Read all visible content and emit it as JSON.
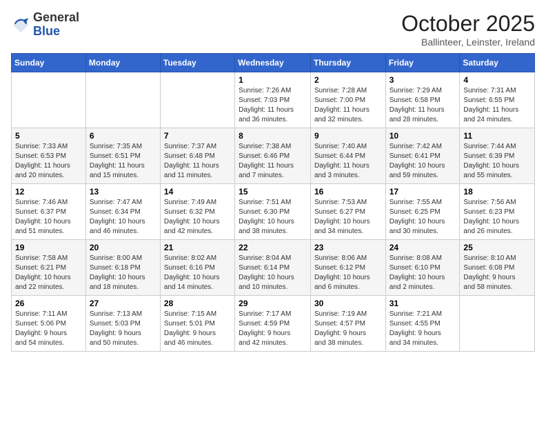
{
  "header": {
    "logo_general": "General",
    "logo_blue": "Blue",
    "month_title": "October 2025",
    "location": "Ballinteer, Leinster, Ireland"
  },
  "days_of_week": [
    "Sunday",
    "Monday",
    "Tuesday",
    "Wednesday",
    "Thursday",
    "Friday",
    "Saturday"
  ],
  "weeks": [
    [
      {
        "day": "",
        "info": ""
      },
      {
        "day": "",
        "info": ""
      },
      {
        "day": "",
        "info": ""
      },
      {
        "day": "1",
        "info": "Sunrise: 7:26 AM\nSunset: 7:03 PM\nDaylight: 11 hours\nand 36 minutes."
      },
      {
        "day": "2",
        "info": "Sunrise: 7:28 AM\nSunset: 7:00 PM\nDaylight: 11 hours\nand 32 minutes."
      },
      {
        "day": "3",
        "info": "Sunrise: 7:29 AM\nSunset: 6:58 PM\nDaylight: 11 hours\nand 28 minutes."
      },
      {
        "day": "4",
        "info": "Sunrise: 7:31 AM\nSunset: 6:55 PM\nDaylight: 11 hours\nand 24 minutes."
      }
    ],
    [
      {
        "day": "5",
        "info": "Sunrise: 7:33 AM\nSunset: 6:53 PM\nDaylight: 11 hours\nand 20 minutes."
      },
      {
        "day": "6",
        "info": "Sunrise: 7:35 AM\nSunset: 6:51 PM\nDaylight: 11 hours\nand 15 minutes."
      },
      {
        "day": "7",
        "info": "Sunrise: 7:37 AM\nSunset: 6:48 PM\nDaylight: 11 hours\nand 11 minutes."
      },
      {
        "day": "8",
        "info": "Sunrise: 7:38 AM\nSunset: 6:46 PM\nDaylight: 11 hours\nand 7 minutes."
      },
      {
        "day": "9",
        "info": "Sunrise: 7:40 AM\nSunset: 6:44 PM\nDaylight: 11 hours\nand 3 minutes."
      },
      {
        "day": "10",
        "info": "Sunrise: 7:42 AM\nSunset: 6:41 PM\nDaylight: 10 hours\nand 59 minutes."
      },
      {
        "day": "11",
        "info": "Sunrise: 7:44 AM\nSunset: 6:39 PM\nDaylight: 10 hours\nand 55 minutes."
      }
    ],
    [
      {
        "day": "12",
        "info": "Sunrise: 7:46 AM\nSunset: 6:37 PM\nDaylight: 10 hours\nand 51 minutes."
      },
      {
        "day": "13",
        "info": "Sunrise: 7:47 AM\nSunset: 6:34 PM\nDaylight: 10 hours\nand 46 minutes."
      },
      {
        "day": "14",
        "info": "Sunrise: 7:49 AM\nSunset: 6:32 PM\nDaylight: 10 hours\nand 42 minutes."
      },
      {
        "day": "15",
        "info": "Sunrise: 7:51 AM\nSunset: 6:30 PM\nDaylight: 10 hours\nand 38 minutes."
      },
      {
        "day": "16",
        "info": "Sunrise: 7:53 AM\nSunset: 6:27 PM\nDaylight: 10 hours\nand 34 minutes."
      },
      {
        "day": "17",
        "info": "Sunrise: 7:55 AM\nSunset: 6:25 PM\nDaylight: 10 hours\nand 30 minutes."
      },
      {
        "day": "18",
        "info": "Sunrise: 7:56 AM\nSunset: 6:23 PM\nDaylight: 10 hours\nand 26 minutes."
      }
    ],
    [
      {
        "day": "19",
        "info": "Sunrise: 7:58 AM\nSunset: 6:21 PM\nDaylight: 10 hours\nand 22 minutes."
      },
      {
        "day": "20",
        "info": "Sunrise: 8:00 AM\nSunset: 6:18 PM\nDaylight: 10 hours\nand 18 minutes."
      },
      {
        "day": "21",
        "info": "Sunrise: 8:02 AM\nSunset: 6:16 PM\nDaylight: 10 hours\nand 14 minutes."
      },
      {
        "day": "22",
        "info": "Sunrise: 8:04 AM\nSunset: 6:14 PM\nDaylight: 10 hours\nand 10 minutes."
      },
      {
        "day": "23",
        "info": "Sunrise: 8:06 AM\nSunset: 6:12 PM\nDaylight: 10 hours\nand 6 minutes."
      },
      {
        "day": "24",
        "info": "Sunrise: 8:08 AM\nSunset: 6:10 PM\nDaylight: 10 hours\nand 2 minutes."
      },
      {
        "day": "25",
        "info": "Sunrise: 8:10 AM\nSunset: 6:08 PM\nDaylight: 9 hours\nand 58 minutes."
      }
    ],
    [
      {
        "day": "26",
        "info": "Sunrise: 7:11 AM\nSunset: 5:06 PM\nDaylight: 9 hours\nand 54 minutes."
      },
      {
        "day": "27",
        "info": "Sunrise: 7:13 AM\nSunset: 5:03 PM\nDaylight: 9 hours\nand 50 minutes."
      },
      {
        "day": "28",
        "info": "Sunrise: 7:15 AM\nSunset: 5:01 PM\nDaylight: 9 hours\nand 46 minutes."
      },
      {
        "day": "29",
        "info": "Sunrise: 7:17 AM\nSunset: 4:59 PM\nDaylight: 9 hours\nand 42 minutes."
      },
      {
        "day": "30",
        "info": "Sunrise: 7:19 AM\nSunset: 4:57 PM\nDaylight: 9 hours\nand 38 minutes."
      },
      {
        "day": "31",
        "info": "Sunrise: 7:21 AM\nSunset: 4:55 PM\nDaylight: 9 hours\nand 34 minutes."
      },
      {
        "day": "",
        "info": ""
      }
    ]
  ]
}
